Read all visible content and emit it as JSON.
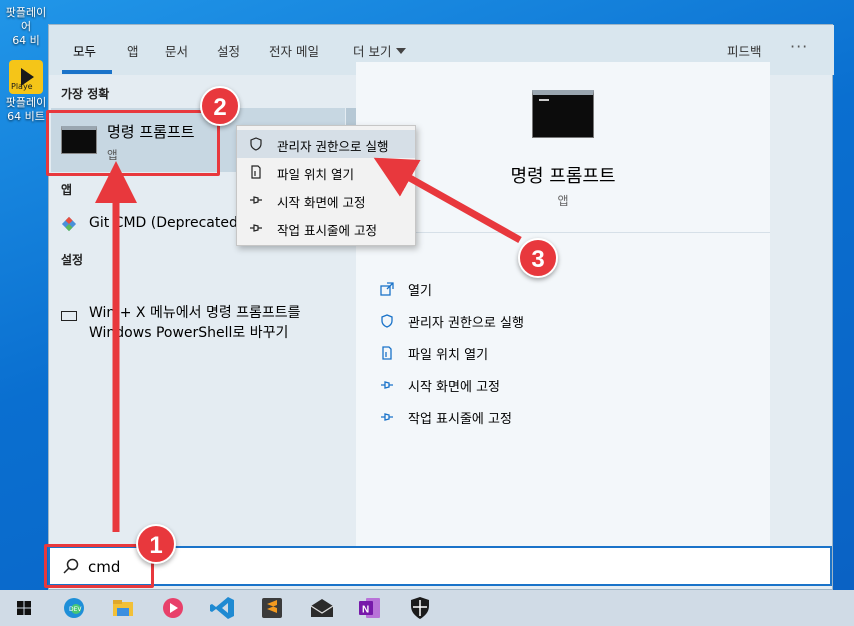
{
  "desktop": {
    "icons": [
      {
        "label_line1": "팟플레이어",
        "label_line2": "64 비"
      },
      {
        "label_line1": "팟플레이",
        "label_line2": "64 비트",
        "tile_text": "Playe"
      }
    ]
  },
  "start_menu": {
    "tabs": [
      "모두",
      "앱",
      "문서",
      "설정",
      "전자 메일",
      "더 보기"
    ],
    "feedback": "피드백",
    "more": "···",
    "sections": {
      "best_match": "가장 정확",
      "apps": "앱",
      "settings": "설정"
    },
    "best_match": {
      "name": "명령 프롬프트",
      "type": "앱"
    },
    "apps": [
      {
        "name": "Git CMD (Deprecated"
      }
    ],
    "settings": [
      {
        "line1": "Win + X 메뉴에서 명령 프롬프트를",
        "line2": "Windows PowerShell로 바꾸기"
      }
    ],
    "preview": {
      "name": "명령 프롬프트",
      "type": "앱",
      "actions": [
        "열기",
        "관리자 권한으로 실행",
        "파일 위치 열기",
        "시작 화면에 고정",
        "작업 표시줄에 고정"
      ]
    }
  },
  "context_menu": {
    "items": [
      "관리자 권한으로 실행",
      "파일 위치 열기",
      "시작 화면에 고정",
      "작업 표시줄에 고정"
    ]
  },
  "search": {
    "value": "cmd"
  },
  "taskbar": {
    "icons": [
      "windows-start-icon",
      "edge-dev-icon",
      "file-explorer-icon",
      "media-player-icon",
      "vscode-icon",
      "sublime-text-icon",
      "mail-icon",
      "onenote-icon",
      "security-icon"
    ]
  },
  "annotations": {
    "badges": [
      "1",
      "2",
      "3"
    ],
    "color": "#e8383d"
  },
  "colors": {
    "accent": "#1a73c9",
    "annotation": "#e8383d"
  }
}
